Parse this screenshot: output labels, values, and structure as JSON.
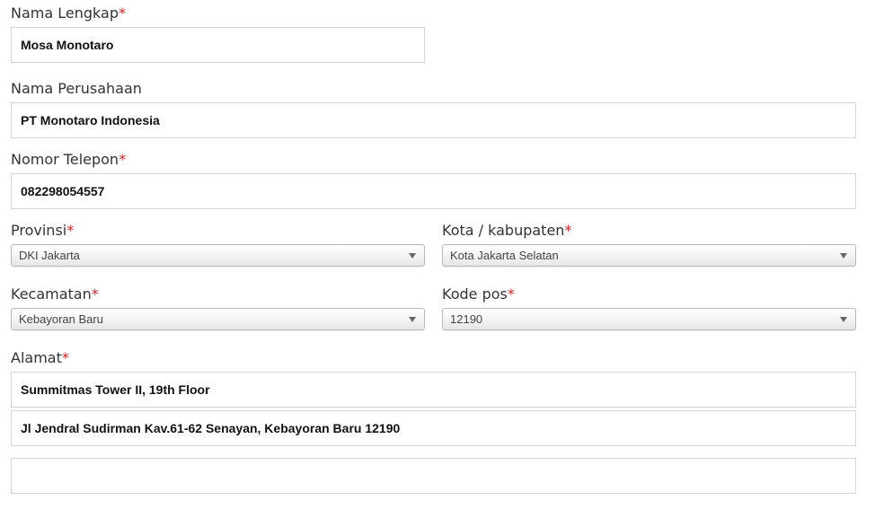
{
  "fields": {
    "nama_lengkap": {
      "label": "Nama Lengkap",
      "required_mark": "*",
      "value": "Mosa Monotaro"
    },
    "nama_perusahaan": {
      "label": "Nama Perusahaan",
      "value": "PT Monotaro Indonesia"
    },
    "nomor_telepon": {
      "label": "Nomor Telepon",
      "required_mark": "*",
      "value": "082298054557"
    },
    "provinsi": {
      "label": "Provinsi",
      "required_mark": "*",
      "selected": "DKI Jakarta"
    },
    "kota": {
      "label": "Kota / kabupaten",
      "required_mark": "*",
      "selected": "Kota Jakarta Selatan"
    },
    "kecamatan": {
      "label": "Kecamatan",
      "required_mark": "*",
      "selected": "Kebayoran Baru"
    },
    "kode_pos": {
      "label": "Kode pos",
      "required_mark": "*",
      "selected": "12190"
    },
    "alamat": {
      "label": "Alamat",
      "required_mark": "*",
      "line1": "Summitmas Tower II, 19th Floor",
      "line2": "Jl Jendral Sudirman Kav.61-62 Senayan, Kebayoran Baru 12190",
      "line3": ""
    }
  },
  "icons": {
    "select_arrow": "chevron-down-icon"
  }
}
